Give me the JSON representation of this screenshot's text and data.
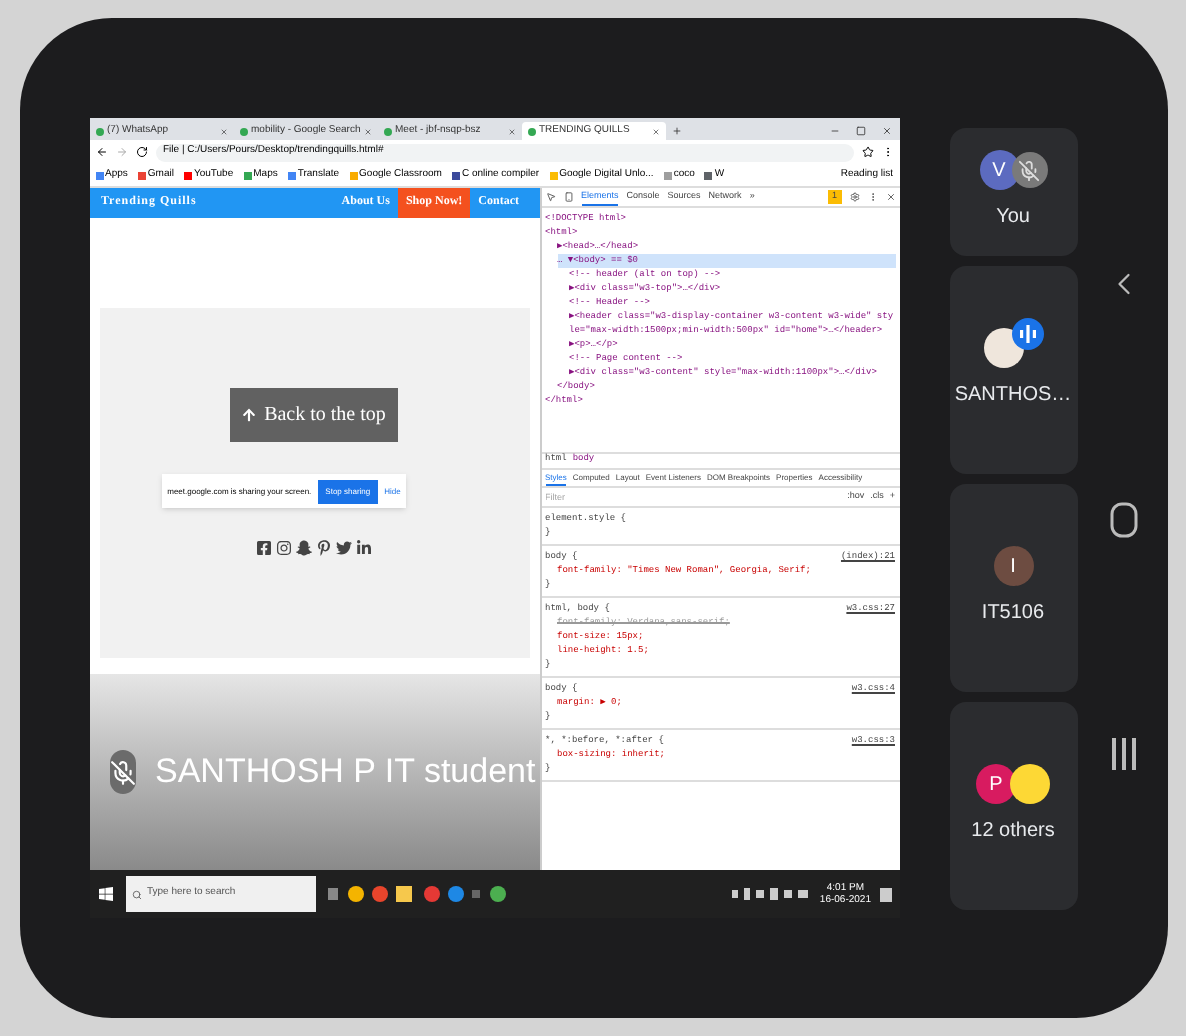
{
  "browser": {
    "tabs": [
      {
        "label": "(7) WhatsApp",
        "selected": false
      },
      {
        "label": "mobility - Google Search",
        "selected": false
      },
      {
        "label": "Meet - jbf-nsqp-bsz",
        "selected": false
      },
      {
        "label": "TRENDING QUILLS",
        "selected": true
      }
    ],
    "address": "File | C:/Users/Pours/Desktop/trendingquills.html#",
    "bookmarks": [
      {
        "label": "Apps",
        "color": "#4285f4"
      },
      {
        "label": "Gmail",
        "color": "#ea4335"
      },
      {
        "label": "YouTube",
        "color": "#ff0000"
      },
      {
        "label": "Maps",
        "color": "#34a853"
      },
      {
        "label": "Translate",
        "color": "#4285f4"
      },
      {
        "label": "Google Classroom",
        "color": "#f9ab00"
      },
      {
        "label": "C online compiler",
        "color": "#3c4a9c"
      },
      {
        "label": "Google Digital Unlo...",
        "color": "#fbbc04"
      },
      {
        "label": "coco",
        "color": "#9e9e9e"
      },
      {
        "label": "W",
        "color": "#5f6368"
      }
    ],
    "reading_list": "Reading list"
  },
  "webpage": {
    "brand": "Trending Quills",
    "nav": [
      {
        "label": "About Us",
        "highlight": false
      },
      {
        "label": "Shop Now!",
        "highlight": true
      },
      {
        "label": "Contact",
        "highlight": false
      }
    ],
    "back_to_top": "Back to the top",
    "share_bar": {
      "message": "meet.google.com is sharing your screen.",
      "stop": "Stop sharing",
      "hide": "Hide"
    }
  },
  "devtools": {
    "tabs": [
      {
        "label": "Elements",
        "selected": true
      },
      {
        "label": "Console",
        "selected": false
      },
      {
        "label": "Sources",
        "selected": false
      },
      {
        "label": "Network",
        "selected": false
      },
      {
        "label": "»",
        "selected": false
      }
    ],
    "warnings": "1",
    "dom": [
      {
        "text": "<!DOCTYPE html>",
        "selected": false
      },
      {
        "text": "<html>",
        "selected": false,
        "children": [
          {
            "text": "▶<head>…</head>",
            "selected": false
          },
          {
            "text": "… ▼<body> == $0",
            "selected": true,
            "children": [
              {
                "text": "<!-- header (alt on top) -->",
                "selected": false
              },
              {
                "text": "▶<div class=\"w3-top\">…</div>",
                "selected": false
              },
              {
                "text": "<!-- Header -->",
                "selected": false
              },
              {
                "text": "▶<header class=\"w3-display-container w3-content w3-wide\" style=\"max-width:1500px;min-width:500px\" id=\"home\">…</header>",
                "selected": false
              },
              {
                "text": "▶<p>…</p>",
                "selected": false
              },
              {
                "text": "<!-- Page content -->",
                "selected": false
              },
              {
                "text": "▶<div class=\"w3-content\" style=\"max-width:1100px\">…</div>",
                "selected": false
              }
            ]
          },
          {
            "text": "</body>",
            "selected": false
          }
        ]
      },
      {
        "text": "</html>",
        "selected": false
      }
    ],
    "breadcrumb": [
      {
        "label": "html",
        "selected": false
      },
      {
        "label": "body",
        "selected": true
      }
    ],
    "style_tabs": [
      {
        "label": "Styles",
        "selected": true
      },
      {
        "label": "Computed",
        "selected": false
      },
      {
        "label": "Layout",
        "selected": false
      },
      {
        "label": "Event Listeners",
        "selected": false
      },
      {
        "label": "DOM Breakpoints",
        "selected": false
      },
      {
        "label": "Properties",
        "selected": false
      },
      {
        "label": "Accessibility",
        "selected": false
      }
    ],
    "filter_placeholder": "Filter",
    "filter_buttons": [
      ":hov",
      ".cls",
      "+"
    ],
    "rules": [
      {
        "selector": "element.style {",
        "close": "}"
      },
      {
        "selector": "body {",
        "source": "(index):21",
        "declarations": [
          {
            "text": "font-family: \"Times New Roman\", Georgia, Serif;",
            "struck": false
          }
        ],
        "close": "}"
      },
      {
        "selector": "html, body {",
        "source": "w3.css:27",
        "declarations": [
          {
            "text": "font-family: Verdana,sans-serif;",
            "struck": true
          },
          {
            "text": "font-size: 15px;",
            "struck": false
          },
          {
            "text": "line-height: 1.5;",
            "struck": false
          }
        ],
        "close": "}"
      },
      {
        "selector": "body {",
        "source": "w3.css:4",
        "declarations": [
          {
            "text": "margin: ▶ 0;",
            "struck": false
          }
        ],
        "close": "}"
      },
      {
        "selector": "*, *:before, *:after {",
        "source": "w3.css:3",
        "declarations": [
          {
            "text": "box-sizing: inherit;",
            "struck": false
          }
        ],
        "close": "}"
      }
    ]
  },
  "presenter": {
    "name": "SANTHOSH P IT student",
    "muted": true
  },
  "taskbar": {
    "search_placeholder": "Type here to search",
    "time": "4:01 PM",
    "date": "16-06-2021"
  },
  "participants": [
    {
      "name": "You",
      "kind": "muted",
      "avatars": [
        {
          "initial": "V",
          "color": "#5c6bc0"
        }
      ]
    },
    {
      "name": "SANTHOS…",
      "kind": "speaking",
      "avatars": [
        {
          "color": "#efe6dc"
        }
      ]
    },
    {
      "name": "IT5106",
      "kind": "none",
      "avatars": [
        {
          "initial": "I",
          "color": "#6d4c41"
        }
      ]
    },
    {
      "name": "12 others",
      "kind": "none",
      "avatars": [
        {
          "initial": "P",
          "color": "#d81b60"
        },
        {
          "color": "#fdd835"
        }
      ]
    }
  ]
}
